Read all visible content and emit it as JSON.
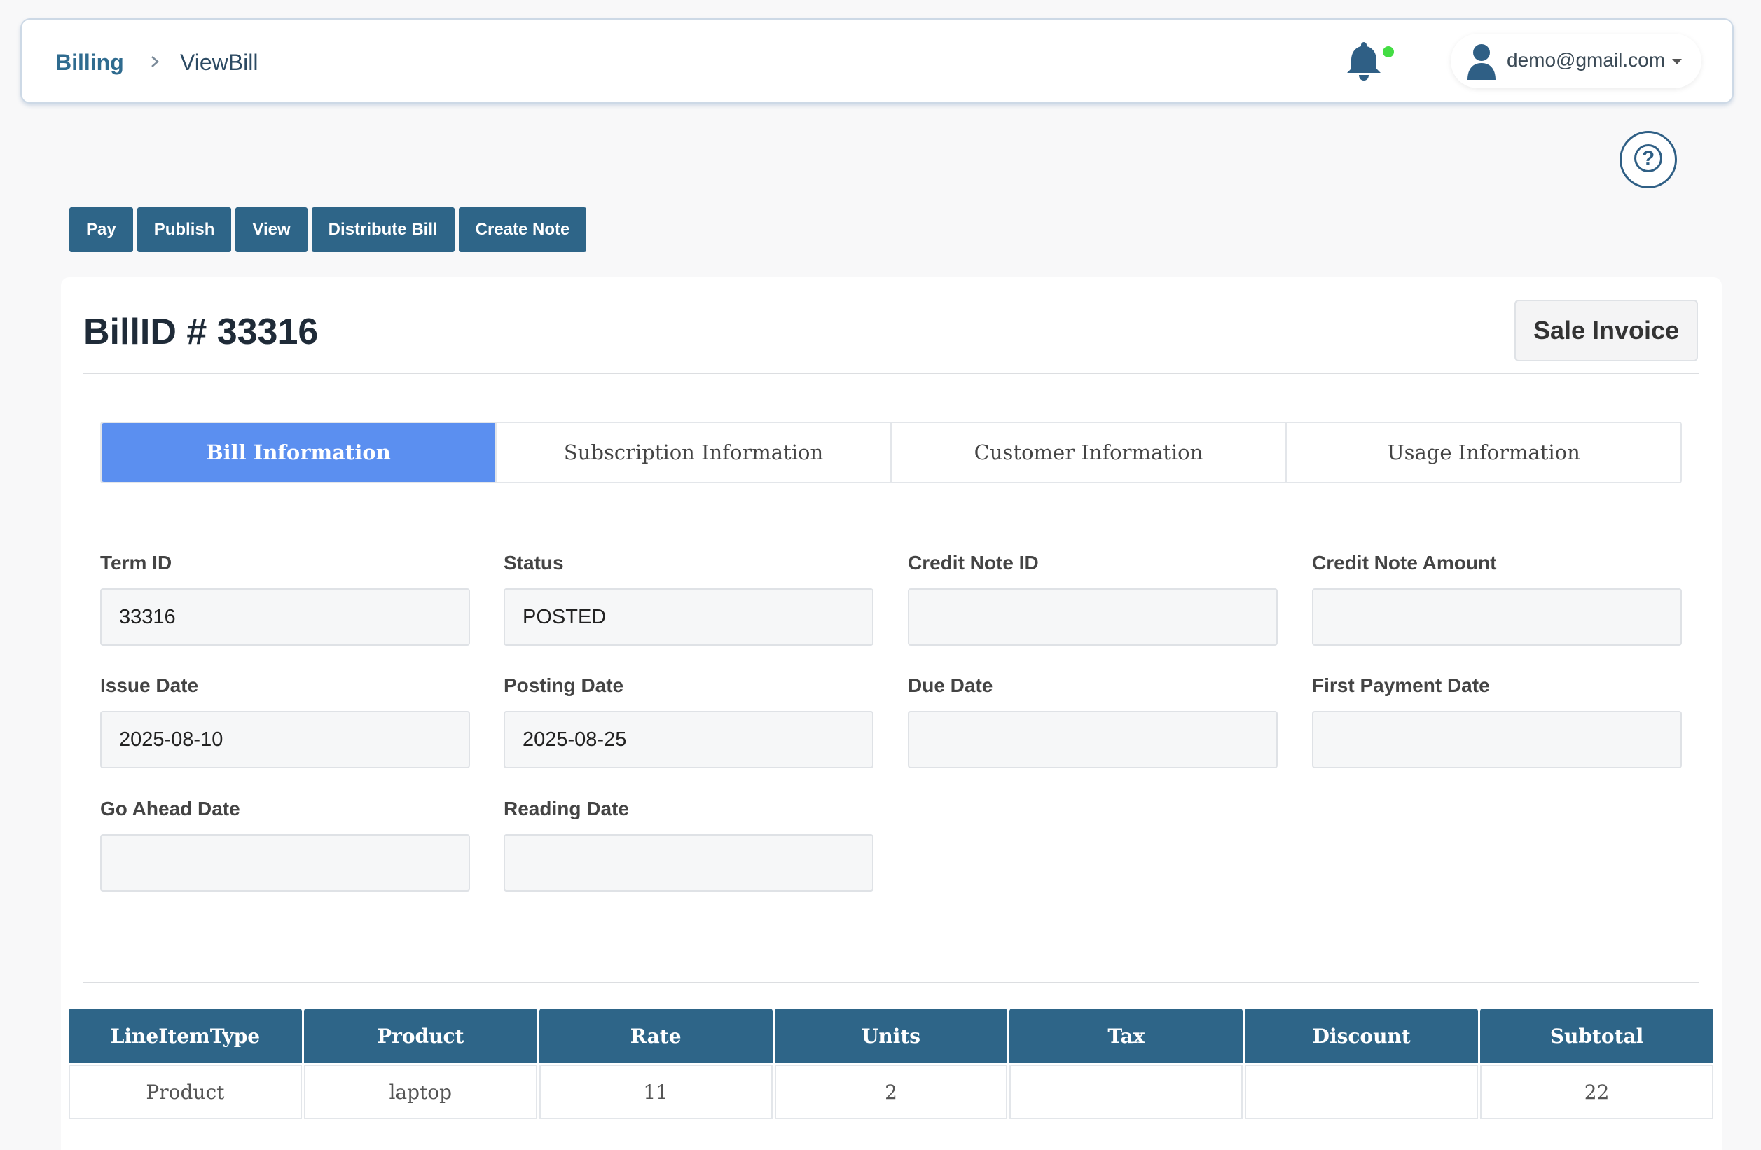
{
  "breadcrumb": {
    "root": "Billing",
    "separator": ">",
    "current": "ViewBill"
  },
  "header": {
    "user_email": "demo@gmail.com",
    "notification_icon": "bell-icon",
    "status_dot_color": "#44dd44"
  },
  "help": {
    "glyph": "?"
  },
  "actions": [
    "Pay",
    "Publish",
    "View",
    "Distribute Bill",
    "Create Note"
  ],
  "bill": {
    "title": "BillID # 33316",
    "type_button": "Sale Invoice"
  },
  "tabs": [
    "Bill Information",
    "Subscription Information",
    "Customer Information",
    "Usage Information"
  ],
  "fields": {
    "term_id": {
      "label": "Term ID",
      "value": "33316"
    },
    "status": {
      "label": "Status",
      "value": "POSTED"
    },
    "credit_note_id": {
      "label": "Credit Note ID",
      "value": ""
    },
    "credit_note_amount": {
      "label": "Credit Note Amount",
      "value": ""
    },
    "issue_date": {
      "label": "Issue Date",
      "value": "2025-08-10"
    },
    "posting_date": {
      "label": "Posting Date",
      "value": "2025-08-25"
    },
    "due_date": {
      "label": "Due Date",
      "value": ""
    },
    "first_payment_date": {
      "label": "First Payment Date",
      "value": ""
    },
    "go_ahead_date": {
      "label": "Go Ahead Date",
      "value": ""
    },
    "reading_date": {
      "label": "Reading Date",
      "value": ""
    }
  },
  "line_items": {
    "headers": [
      "LineItemType",
      "Product",
      "Rate",
      "Units",
      "Tax",
      "Discount",
      "Subtotal"
    ],
    "rows": [
      [
        "Product",
        "laptop",
        "11",
        "2",
        "",
        "",
        "22"
      ]
    ]
  },
  "colors": {
    "primary": "#2e6588",
    "active_tab": "#5b8ff0",
    "breadcrumb": "#2f6b8f"
  }
}
